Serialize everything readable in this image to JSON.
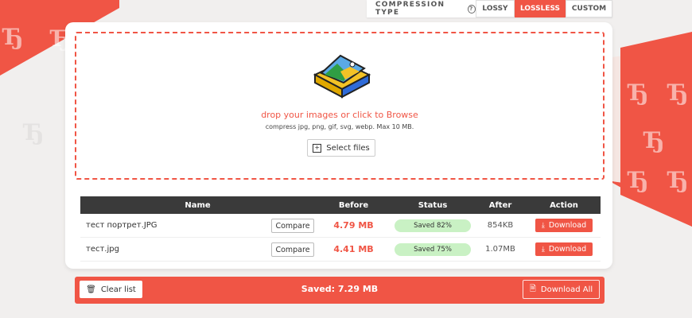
{
  "compression": {
    "label": "COMPRESSION TYPE",
    "options": [
      {
        "label": "LOSSY",
        "active": false
      },
      {
        "label": "LOSSLESS",
        "active": true
      },
      {
        "label": "CUSTOM",
        "active": false
      }
    ]
  },
  "dropzone": {
    "title": "drop your images or click to Browse",
    "subtitle": "compress jpg, png, gif, svg, webp. Max 10 MB.",
    "select_label": "Select files"
  },
  "table": {
    "headers": {
      "name": "Name",
      "before": "Before",
      "status": "Status",
      "after": "After",
      "action": "Action"
    },
    "rows": [
      {
        "name": "тест портрет.JPG",
        "compare": "Compare",
        "before": "4.79 MB",
        "status": "Saved 82%",
        "after": "854KB",
        "action": "Download"
      },
      {
        "name": "тест.jpg",
        "compare": "Compare",
        "before": "4.41 MB",
        "status": "Saved 75%",
        "after": "1.07MB",
        "action": "Download"
      }
    ]
  },
  "footer": {
    "clear_label": "Clear list",
    "saved_text": "Saved: 7.29 MB",
    "download_all_label": "Download All"
  },
  "colors": {
    "accent": "#f05545",
    "status_bg": "#c9f1c4",
    "header_bg": "#3a3a3a"
  }
}
